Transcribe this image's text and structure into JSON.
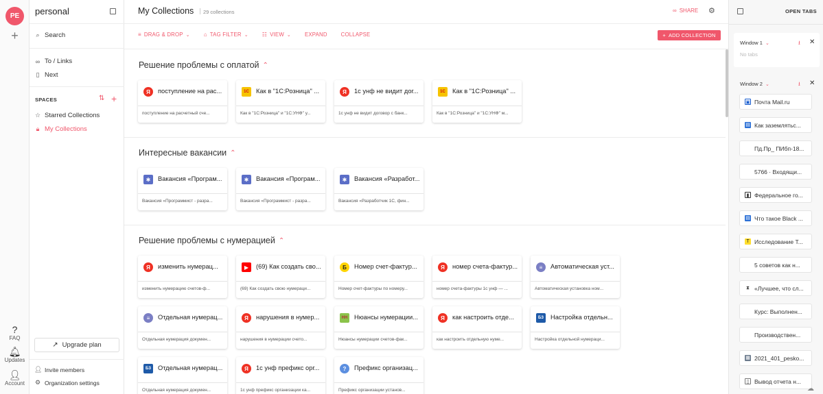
{
  "rail": {
    "avatar": "PE",
    "add": "+",
    "faq": "FAQ",
    "updates": "Updates",
    "account": "Account"
  },
  "sidebar": {
    "workspace": "personal",
    "search": "Search",
    "links": [
      "To / Links",
      "Next"
    ],
    "spaces_label": "SPACES",
    "spaces": [
      {
        "label": "Starred Collections",
        "active": false
      },
      {
        "label": "My Collections",
        "active": true
      }
    ],
    "upgrade": "Upgrade plan",
    "invite": "Invite members",
    "org_settings": "Organization settings"
  },
  "main": {
    "title": "My Collections",
    "count": "29 collections",
    "share": "SHARE",
    "toolbar": {
      "drag_drop": "DRAG & DROP",
      "tag_filter": "TAG FILTER",
      "view": "VIEW",
      "expand": "EXPAND",
      "collapse": "COLLAPSE",
      "add_collection": "ADD COLLECTION"
    },
    "sections": [
      {
        "title": "Решение проблемы с оплатой",
        "cards": [
          {
            "icon": "yandex-icon",
            "title": "поступление на рас...",
            "desc": "поступление на расчетный сче..."
          },
          {
            "icon": "1c-icon",
            "title": "Как в \"1С:Розница\" ...",
            "desc": "Как в \"1С:Розница\" и \"1С:УНФ\" у..."
          },
          {
            "icon": "yandex-icon",
            "title": "1с унф не видит дог...",
            "desc": "1с унф не видит договор с банк..."
          },
          {
            "icon": "1c-icon",
            "title": "Как в \"1С:Розница\" ...",
            "desc": "Как в \"1С:Розница\" и \"1С:УНФ\" м..."
          }
        ]
      },
      {
        "title": "Интересные вакансии",
        "cards": [
          {
            "icon": "job-icon",
            "title": "Вакансия «Програм...",
            "desc": "Вакансия «Программист - разра..."
          },
          {
            "icon": "job-icon",
            "title": "Вакансия «Програм...",
            "desc": "Вакансия «Программист - разра..."
          },
          {
            "icon": "job-icon",
            "title": "Вакансия «Разработ...",
            "desc": "Вакансия «Разработчик 1С, фин..."
          }
        ]
      },
      {
        "title": "Решение проблемы с нумерацией",
        "cards": [
          {
            "icon": "yandex-icon",
            "title": "изменить нумерац...",
            "desc": "изменить нумерацию счетов-ф..."
          },
          {
            "icon": "youtube-icon",
            "title": "(69) Как создать сво...",
            "desc": "(69) Как создать свою нумераци..."
          },
          {
            "icon": "buh-icon",
            "title": "Номер счет-фактур...",
            "desc": "Номер счет-фактуры по номеру..."
          },
          {
            "icon": "yandex-icon",
            "title": "номер счета-фактур...",
            "desc": "номер счета-фактуры 1с унф — ..."
          },
          {
            "icon": "db-icon",
            "title": "Автоматическая уст...",
            "desc": "Автоматическая установка ном..."
          },
          {
            "icon": "db-icon",
            "title": "Отдельная нумерац...",
            "desc": "Отдельная нумерация докумен..."
          },
          {
            "icon": "yandex-icon",
            "title": "нарушения в нумер...",
            "desc": "нарушения в нумерации счето..."
          },
          {
            "icon": "hh-icon",
            "title": "Нюансы нумерации...",
            "desc": "Нюансы нумерации счетов-фак..."
          },
          {
            "icon": "yandex-icon",
            "title": "как настроить отде...",
            "desc": "как настроить отдельную нуме..."
          },
          {
            "icon": "bz-icon",
            "title": "Настройка отдельн...",
            "desc": "Настройка отдельной нумераци..."
          },
          {
            "icon": "bz-icon",
            "title": "Отдельная нумерац...",
            "desc": "Отдельная нумерация докумен..."
          },
          {
            "icon": "yandex-icon",
            "title": "1с унф префикс орг...",
            "desc": "1с унф префикс организации ка..."
          },
          {
            "icon": "help-icon",
            "title": "Префикс организац...",
            "desc": "Префикс организации установ..."
          }
        ]
      }
    ]
  },
  "right": {
    "title": "OPEN TABS",
    "window1": "Window 1",
    "no_tabs": "No tabs",
    "window2": "Window 2",
    "tabs": [
      {
        "icon": "mail-icon",
        "label": "Почта Mail.ru"
      },
      {
        "icon": "doc-icon",
        "label": "Как заземлятьс..."
      },
      {
        "icon": "blank-icon",
        "label": "Пд.Пр_ ПИбп-18..."
      },
      {
        "icon": "blank-icon",
        "label": "5766 · Входящи..."
      },
      {
        "icon": "fed-icon",
        "label": "Федеральное го..."
      },
      {
        "icon": "doc-icon",
        "label": "Что такое Black ..."
      },
      {
        "icon": "t-icon",
        "label": "Исследование Т..."
      },
      {
        "icon": "blank-icon",
        "label": "5 советов как н..."
      },
      {
        "icon": "x-icon",
        "label": "«Лучшее, что сл..."
      },
      {
        "icon": "blank-icon",
        "label": "Курс: Выполнен..."
      },
      {
        "icon": "blank-icon",
        "label": "Производствен..."
      },
      {
        "icon": "image-icon",
        "label": "2021_401_pesko..."
      },
      {
        "icon": "file-icon",
        "label": "Вывод отчета н..."
      }
    ]
  },
  "colors": {
    "accent": "#f0576b"
  }
}
